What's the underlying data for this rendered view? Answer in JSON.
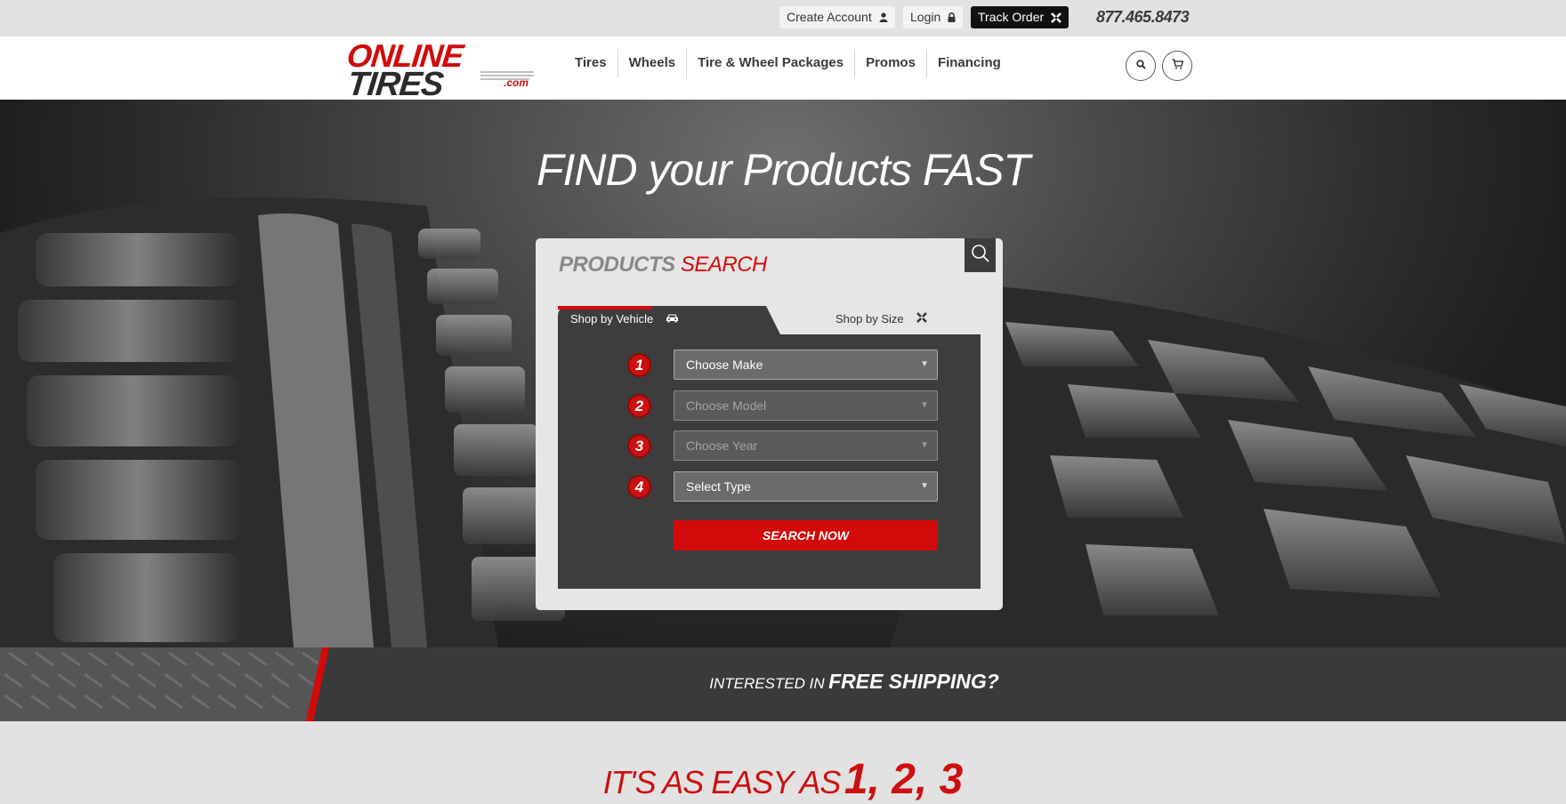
{
  "topbar": {
    "create_account": "Create Account",
    "login": "Login",
    "track_order": "Track Order",
    "phone": "877.465.8473"
  },
  "logo": {
    "line1": "ONLINE",
    "line2": "TIRES",
    "suffix": ".com"
  },
  "nav": {
    "items": [
      {
        "label": "Tires"
      },
      {
        "label": "Wheels"
      },
      {
        "label": "Tire & Wheel Packages"
      },
      {
        "label": "Promos"
      },
      {
        "label": "Financing"
      }
    ]
  },
  "hero": {
    "title": "FIND your Products FAST"
  },
  "search": {
    "title_part1": "PRODUCTS",
    "title_part2": "SEARCH",
    "tabs": [
      {
        "label": "Shop by Vehicle",
        "icon": "car-icon",
        "active": true
      },
      {
        "label": "Shop by Size",
        "icon": "tire-size-icon",
        "active": false
      }
    ],
    "fields": [
      {
        "number": "1",
        "placeholder": "Choose Make",
        "enabled": true
      },
      {
        "number": "2",
        "placeholder": "Choose Model",
        "enabled": false
      },
      {
        "number": "3",
        "placeholder": "Choose Year",
        "enabled": false
      },
      {
        "number": "4",
        "placeholder": "Select Type",
        "enabled": true
      }
    ],
    "submit_label": "SEARCH NOW"
  },
  "band": {
    "small": "INTERESTED IN",
    "big": "FREE SHIPPING?"
  },
  "easy": {
    "small": "IT'S AS EASY AS",
    "big": "1, 2, 3"
  },
  "colors": {
    "brand_red": "#d20a0a",
    "dark_gray": "#3a3a3a",
    "light_gray": "#e2e2e2"
  }
}
